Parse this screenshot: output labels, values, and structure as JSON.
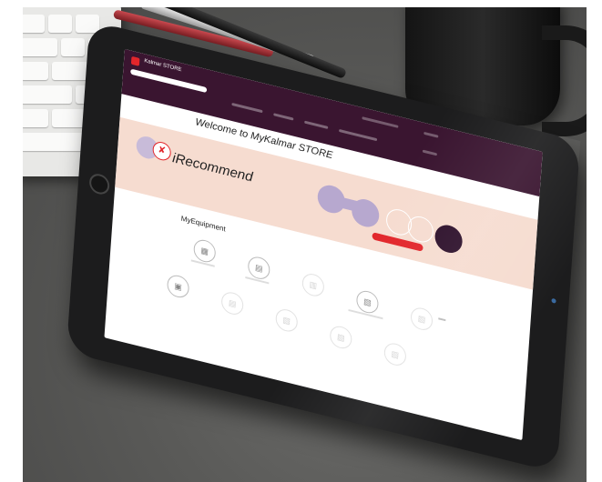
{
  "photo": {
    "subject": "Tablet on a desk showing the MyKalmar STORE web page",
    "background_color": "#5a5a58"
  },
  "store": {
    "brand": "Kalmar STORE",
    "search_placeholder": "",
    "nav": [],
    "account_links": [],
    "welcome_title": "Welcome to MyKalmar STORE",
    "banner_title": "iRecommend",
    "section_title": "MyEquipment",
    "colors": {
      "header": "#3a1530",
      "banner": "#f6dcd0",
      "accent": "#e2262b",
      "bubble": "#b7a8cf",
      "dark_circle": "#2c0f2a"
    },
    "equipment_icons": [
      "reach-stacker-icon",
      "terminal-tractor-icon",
      "forklift-icon",
      "rtg-crane-icon",
      "straddle-carrier-icon",
      "container-handler-icon",
      "empty-handler-icon",
      "crane-icon",
      "spreader-icon",
      "truck-icon"
    ]
  }
}
